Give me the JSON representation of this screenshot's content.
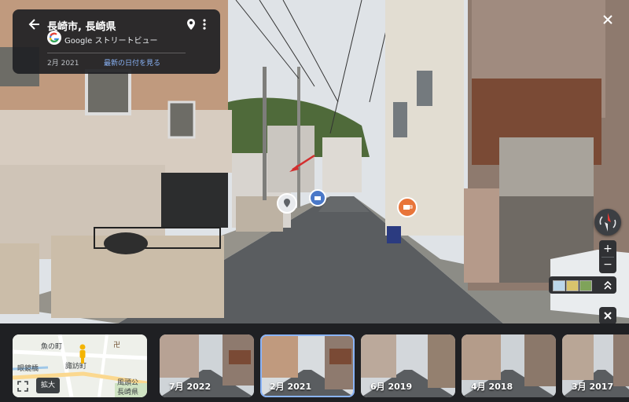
{
  "header": {
    "location": "長崎市, 長崎県",
    "provider": "Google ストリートビュー",
    "current_date": "2月 2021",
    "see_latest_label": "最新の日付を見る"
  },
  "icons": {
    "back": "arrow-left-icon",
    "pin": "location-pin-icon",
    "more": "more-vert-icon",
    "close": "close-icon",
    "compass": "compass-icon",
    "zoom_in": "plus-icon",
    "zoom_out": "minus-icon",
    "layers_toggle": "chevron-up-double-icon",
    "expand": "fullscreen-icon"
  },
  "controls": {
    "zoom_in_label": "+",
    "zoom_out_label": "−"
  },
  "minimap": {
    "labels": [
      "魚の町",
      "眼鏡橋",
      "諏訪町",
      "風頭公",
      "長崎県"
    ],
    "shrine_symbol": "卍",
    "expand_label": "拡大"
  },
  "timeline": [
    {
      "date": "7月 2022",
      "selected": false
    },
    {
      "date": "2月 2021",
      "selected": true
    },
    {
      "date": "6月 2019",
      "selected": false
    },
    {
      "date": "4月 2018",
      "selected": false
    },
    {
      "date": "3月 2017",
      "selected": false
    }
  ],
  "colors": {
    "accent_blue": "#8ab4f8",
    "panel_bg": "#202124",
    "strip_bg": "#1f2023",
    "cafe_marker": "#e8753a"
  }
}
